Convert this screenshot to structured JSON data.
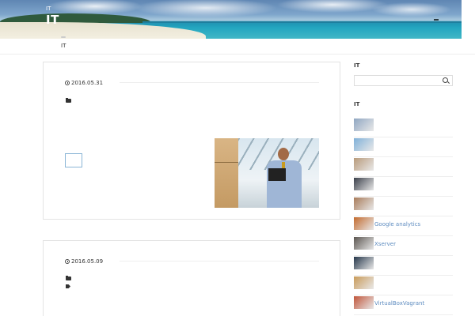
{
  "header": {
    "site_small": "IT",
    "site_title": "IT"
  },
  "nav": {
    "items": [
      "IT"
    ]
  },
  "posts": [
    {
      "date": "2016.05.31"
    },
    {
      "date": "2016.05.09"
    }
  ],
  "sidebar": {
    "search_heading": "IT",
    "list_heading": "IT",
    "items": [
      {
        "label": "",
        "thumb_color": "#8fa6c1"
      },
      {
        "label": "",
        "thumb_color": "#7fb0d8"
      },
      {
        "label": "",
        "thumb_color": "#b89a7a"
      },
      {
        "label": "",
        "thumb_color": "#3a3f4a"
      },
      {
        "label": "",
        "thumb_color": "#a87b5a"
      },
      {
        "label": "Google analytics",
        "thumb_color": "#c26a2e"
      },
      {
        "label": "Xserver",
        "thumb_color": "#5b5550"
      },
      {
        "label": "",
        "thumb_color": "#25364a"
      },
      {
        "label": "",
        "thumb_color": "#c89a5a"
      },
      {
        "label": "VirtualBoxVagrant",
        "thumb_color": "#c0553a"
      }
    ]
  }
}
